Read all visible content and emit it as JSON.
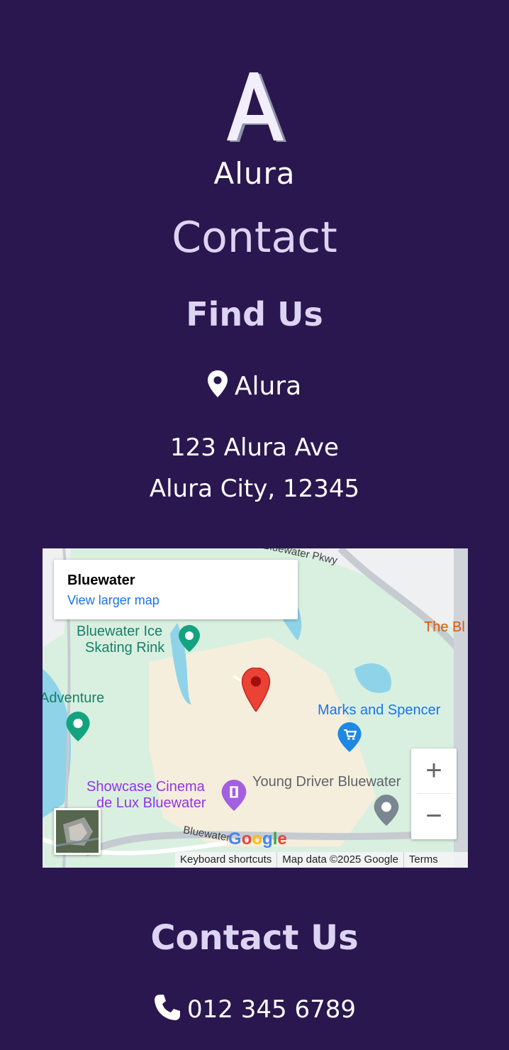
{
  "brand": {
    "logo_letter": "A",
    "name": "Alura"
  },
  "page_title": "Contact",
  "find_us": {
    "heading": "Find Us",
    "location_name": "Alura",
    "address_line1": "123 Alura Ave",
    "address_line2": "Alura City, 12345"
  },
  "map": {
    "info_title": "Bluewater",
    "info_link": "View larger map",
    "labels": {
      "road_top": "Bluewater Pkwy",
      "ice_rink_1": "Bluewater Ice",
      "ice_rink_2": "Skating Rink",
      "adventure": "Adventure",
      "marks": "Marks and Spencer",
      "the_bl": "The Bl",
      "cinema_1": "Showcase Cinema",
      "cinema_2": "de Lux Bluewater",
      "young_driver": "Young Driver Bluewater",
      "road_bottom": "Bluewater"
    },
    "zoom_in": "+",
    "zoom_out": "−",
    "google_letters": [
      "G",
      "o",
      "o",
      "g",
      "l",
      "e"
    ],
    "google_colors": [
      "#4285F4",
      "#EA4335",
      "#FBBC05",
      "#4285F4",
      "#34A853",
      "#EA4335"
    ],
    "attribution": {
      "shortcuts": "Keyboard shortcuts",
      "data": "Map data ©2025 Google",
      "terms": "Terms"
    }
  },
  "contact_us": {
    "heading": "Contact Us",
    "phone": "012 345 6789"
  },
  "icons": {
    "location": "map-pin-icon",
    "phone": "phone-icon"
  },
  "colors": {
    "background": "#2a174f",
    "heading": "#ddd3f3",
    "text": "#ffffff"
  }
}
